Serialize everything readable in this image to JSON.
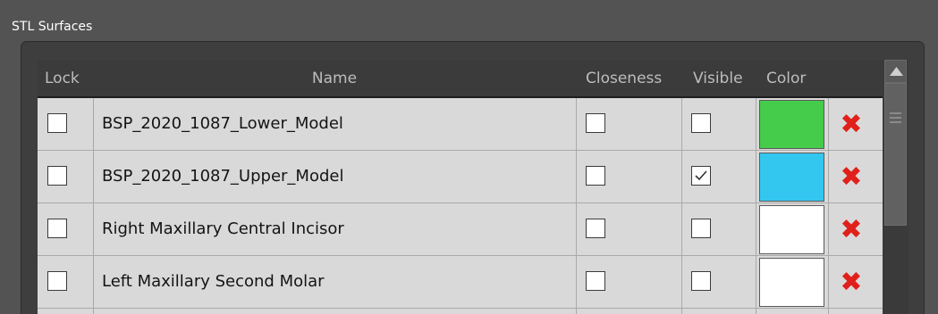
{
  "group": {
    "title": "STL Surfaces"
  },
  "table": {
    "columns": {
      "lock": "Lock",
      "name": "Name",
      "closeness": "Closeness",
      "visible": "Visible",
      "color": "Color"
    },
    "rows": [
      {
        "lock": false,
        "name": "BSP_2020_1087_Lower_Model",
        "closeness": false,
        "visible": false,
        "color": "#44cc4a",
        "delete_icon": "red-x-icon"
      },
      {
        "lock": false,
        "name": "BSP_2020_1087_Upper_Model",
        "closeness": false,
        "visible": true,
        "color": "#33c7f0",
        "delete_icon": "red-x-icon"
      },
      {
        "lock": false,
        "name": "Right Maxillary Central Incisor",
        "closeness": false,
        "visible": false,
        "color": "#ffffff",
        "delete_icon": "red-x-icon"
      },
      {
        "lock": false,
        "name": "Left Maxillary Second Molar",
        "closeness": false,
        "visible": false,
        "color": "#ffffff",
        "delete_icon": "red-x-icon"
      }
    ]
  },
  "colors": {
    "background": "#535353",
    "header_bg": "#3b3b3b",
    "row_bg": "#d9d9d9",
    "delete_icon": "#e0201a"
  }
}
